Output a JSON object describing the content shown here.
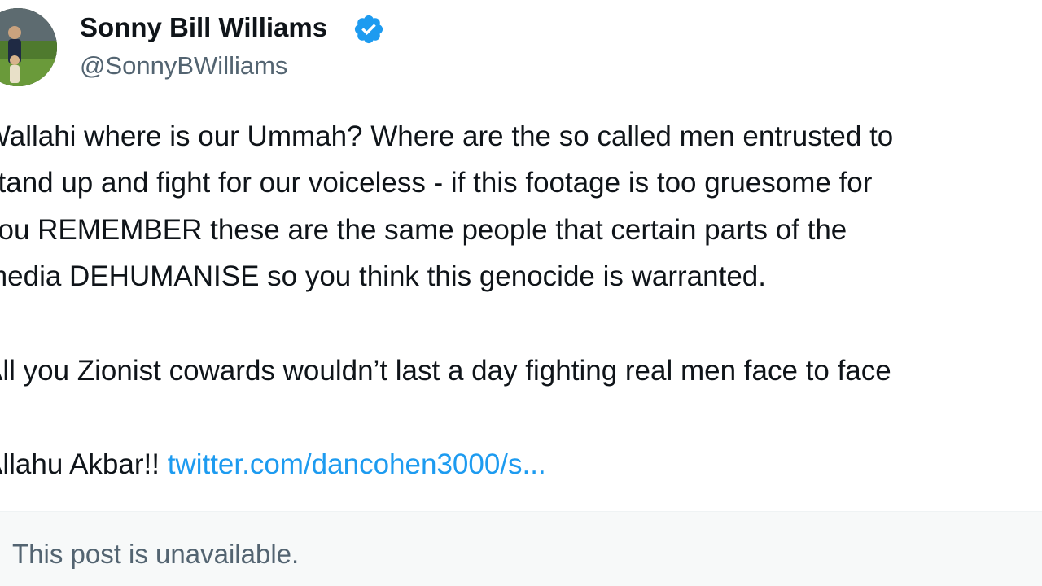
{
  "author": {
    "name": "Sonny Bill Williams",
    "handle": "@SonnyBWilliams",
    "verified": true,
    "verified_icon": "verified-badge-icon",
    "avatar": "profile-photo"
  },
  "post": {
    "lines": [
      "Wallahi where is our Ummah? Where are the so called men entrusted to",
      "stand up and fight for our voiceless - if this footage is too gruesome for",
      "you REMEMBER these are the same people that certain parts of the",
      "media DEHUMANISE so you think this genocide is warranted.",
      "All you Zionist cowards wouldn’t last a day fighting real men face to face"
    ],
    "closing_text": "Allahu Akbar!! ",
    "link_text": "twitter.com/dancohen3000/s..."
  },
  "quoted_post": {
    "text": "This post is unavailable."
  },
  "colors": {
    "link": "#1d9bf0",
    "verified": "#1d9bf0",
    "muted": "#536471",
    "text": "#0f1419",
    "card_bg": "#f7f9f9"
  }
}
